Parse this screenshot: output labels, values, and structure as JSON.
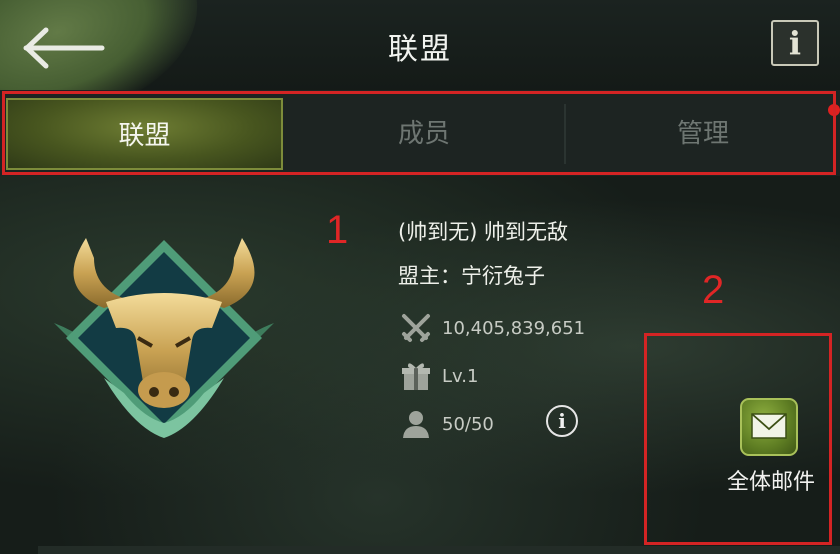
{
  "header": {
    "back_icon": "arrow-left-icon",
    "title": "联盟",
    "info_label": "i"
  },
  "tabs": [
    {
      "label": "联盟",
      "active": true
    },
    {
      "label": "成员",
      "active": false
    },
    {
      "label": "管理",
      "active": false
    }
  ],
  "annotations": {
    "marker_1": "1",
    "marker_2": "2",
    "highlight_color": "#d42424"
  },
  "alliance": {
    "emblem": "bull-emblem-icon",
    "name": "(帅到无) 帅到无敌",
    "leader": "盟主：宁衍兔子",
    "power": "10,405,839,651",
    "level": "Lv.1",
    "members": "50/50",
    "members_info_label": "i"
  },
  "actions": {
    "mail_label": "全体邮件",
    "mail_icon": "envelope-icon"
  },
  "colors": {
    "active_tab": "#5a6a28",
    "background": "#141a17"
  }
}
